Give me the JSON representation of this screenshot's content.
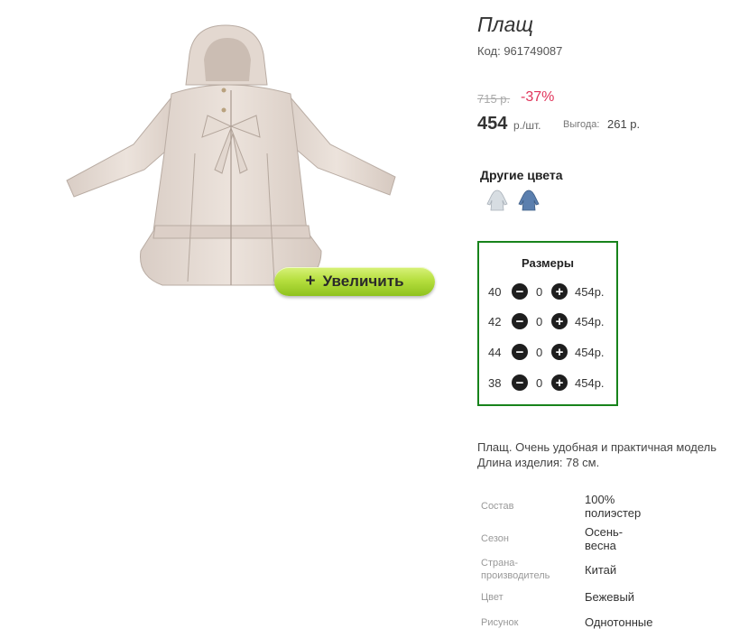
{
  "product": {
    "title": "Плащ",
    "code": "Код: 961749087",
    "old_price": "715 р.",
    "discount": "-37%",
    "price": "454",
    "unit": "р./шт.",
    "benefit_label": "Выгода:",
    "benefit_value": "261 р."
  },
  "zoom_button": {
    "label": "Увеличить",
    "icon": "plus-icon"
  },
  "other_colors": {
    "title": "Другие цвета",
    "swatches": [
      {
        "name": "beige-coat",
        "color": "#d7dde2"
      },
      {
        "name": "blue-coat",
        "color": "#5b7fae"
      }
    ]
  },
  "sizes": {
    "title": "Размеры",
    "border_color": "#17831b",
    "rows": [
      {
        "size": "40",
        "qty": "0",
        "price": "454р."
      },
      {
        "size": "42",
        "qty": "0",
        "price": "454р."
      },
      {
        "size": "44",
        "qty": "0",
        "price": "454р."
      },
      {
        "size": "38",
        "qty": "0",
        "price": "454р."
      }
    ]
  },
  "description": {
    "line1": "Плащ. Очень удобная и практичная модель",
    "line2": "Длина изделия: 78 см."
  },
  "specs": [
    {
      "label": "Состав",
      "value": "100% полиэстер"
    },
    {
      "label": "Сезон",
      "value": "Осень-весна"
    },
    {
      "label": "Страна-производитель",
      "value": "Китай"
    },
    {
      "label": "Цвет",
      "value": "Бежевый"
    },
    {
      "label": "Рисунок",
      "value": "Однотонные"
    }
  ],
  "colors": {
    "accent_green": "#9fd02a",
    "discount_red": "#e0345a"
  }
}
